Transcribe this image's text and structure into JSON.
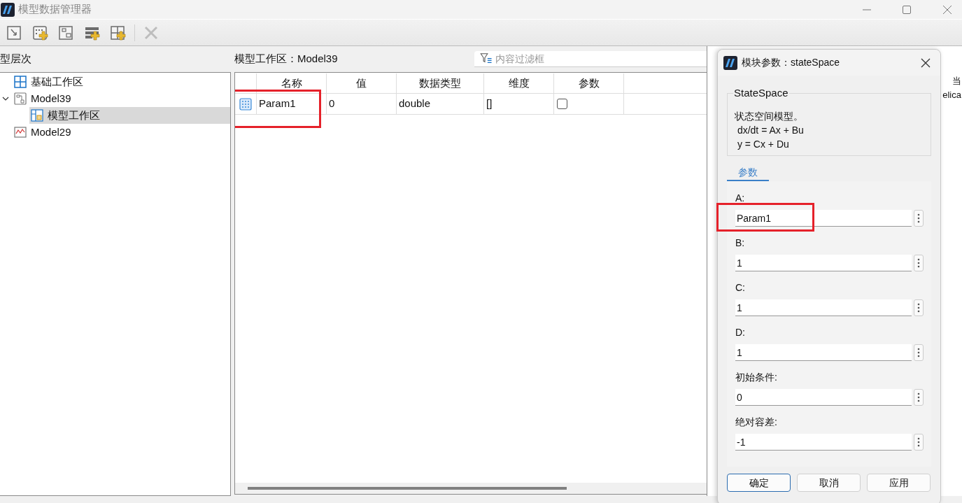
{
  "window": {
    "title": "模型数据管理器"
  },
  "toolbar": [
    {
      "kind": "import",
      "disabled": false
    },
    {
      "kind": "add-signal",
      "disabled": false
    },
    {
      "kind": "add-block",
      "disabled": false
    },
    {
      "kind": "add-row",
      "disabled": false
    },
    {
      "kind": "add-grid",
      "disabled": false
    },
    {
      "kind": "delete",
      "disabled": true
    }
  ],
  "hierarchy": {
    "title": "型层次",
    "items": [
      {
        "kind": "workspace",
        "label": "基础工作区",
        "selected": false
      },
      {
        "kind": "model",
        "label": "Model39",
        "selected": false,
        "expanded": true,
        "children": [
          {
            "kind": "model-workspace",
            "label": "模型工作区",
            "selected": true
          }
        ]
      },
      {
        "kind": "chart-model",
        "label": "Model29",
        "selected": false
      }
    ]
  },
  "workspace": {
    "title": "模型工作区：Model39",
    "filter": {
      "placeholder": "内容过滤框"
    },
    "columns": [
      "名称",
      "值",
      "数据类型",
      "维度",
      "参数"
    ],
    "rows": [
      {
        "name": "Param1",
        "value": "0",
        "type": "double",
        "dimension": "[]",
        "parameter": false,
        "highlighted": true
      }
    ]
  },
  "side_panel": {
    "texts": [
      "当",
      "elica"
    ]
  },
  "dialog": {
    "title": "模块参数：stateSpace",
    "group": {
      "title": "StateSpace",
      "lines": [
        "状态空间模型。",
        " dx/dt = Ax + Bu",
        " y = Cx + Du"
      ]
    },
    "tabs": [
      {
        "label": "参数",
        "selected": true
      }
    ],
    "params": [
      {
        "label": "A:",
        "value": "Param1",
        "highlighted": true
      },
      {
        "label": "B:",
        "value": "1",
        "highlighted": false
      },
      {
        "label": "C:",
        "value": "1",
        "highlighted": false
      },
      {
        "label": "D:",
        "value": "1",
        "highlighted": false
      },
      {
        "label": "初始条件:",
        "value": "0",
        "highlighted": false
      },
      {
        "label": "绝对容差:",
        "value": "-1",
        "highlighted": false
      }
    ],
    "buttons": [
      {
        "label": "确定",
        "default": true
      },
      {
        "label": "取消",
        "default": false
      },
      {
        "label": "应用",
        "default": false
      }
    ]
  }
}
